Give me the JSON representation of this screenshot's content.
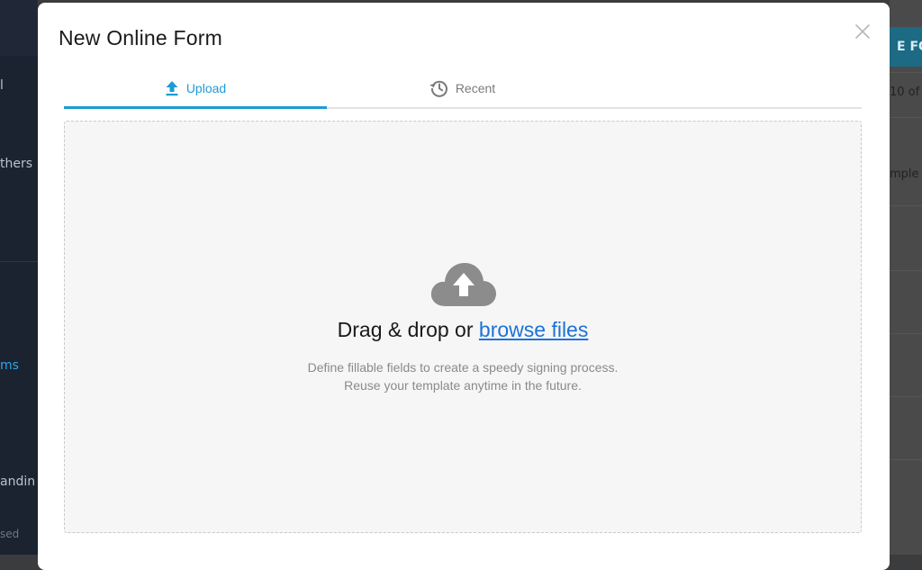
{
  "background": {
    "sidebar_items": [
      "l",
      "thers",
      "ms",
      "andin",
      "sed"
    ],
    "main_button": "E FO",
    "main_texts": [
      "10 of",
      "mple"
    ]
  },
  "modal": {
    "title": "New Online Form",
    "close_icon": "close-icon",
    "tabs": [
      {
        "label": "Upload",
        "icon": "upload-arrow-icon",
        "active": true
      },
      {
        "label": "Recent",
        "icon": "history-icon",
        "active": false
      }
    ],
    "dropzone": {
      "icon": "cloud-upload-icon",
      "prefix": "Drag & drop or ",
      "link": "browse files",
      "line1": "Define fillable fields to create a speedy signing process.",
      "line2": "Reuse your template anytime in the future."
    }
  },
  "colors": {
    "accent": "#1e9bd4",
    "link": "#1b73d8",
    "overlay": "#3a3c3e"
  }
}
